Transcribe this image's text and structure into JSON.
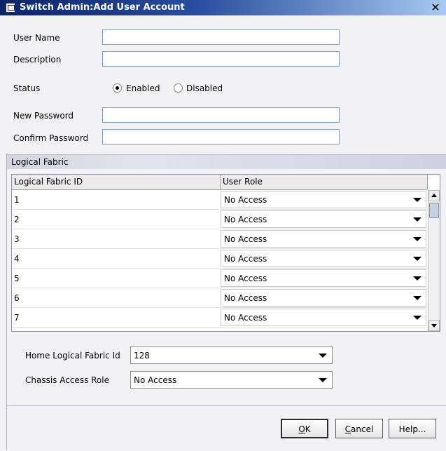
{
  "window": {
    "title": "Switch Admin:Add User Account",
    "close_glyph": "✕"
  },
  "form": {
    "user_name": {
      "label": "User Name",
      "value": ""
    },
    "description": {
      "label": "Description",
      "value": ""
    },
    "status": {
      "label": "Status",
      "options": [
        "Enabled",
        "Disabled"
      ],
      "selected": "Enabled"
    },
    "new_password": {
      "label": "New Password",
      "value": ""
    },
    "confirm_password": {
      "label": "Confirm Password",
      "value": ""
    }
  },
  "logical_fabric": {
    "section_title": "Logical Fabric",
    "columns": [
      "Logical Fabric ID",
      "User Role"
    ],
    "rows": [
      {
        "id": "1",
        "role": "No Access"
      },
      {
        "id": "2",
        "role": "No Access"
      },
      {
        "id": "3",
        "role": "No Access"
      },
      {
        "id": "4",
        "role": "No Access"
      },
      {
        "id": "5",
        "role": "No Access"
      },
      {
        "id": "6",
        "role": "No Access"
      },
      {
        "id": "7",
        "role": "No Access"
      }
    ],
    "home_fabric": {
      "label": "Home Logical Fabric Id",
      "value": "128"
    },
    "chassis_role": {
      "label": "Chassis Access Role",
      "value": "No Access"
    }
  },
  "buttons": {
    "ok": {
      "mnemonic": "O",
      "rest": "K"
    },
    "cancel": {
      "mnemonic": "C",
      "rest": "ancel"
    },
    "help": {
      "label": "Help..."
    }
  },
  "colors": {
    "title_start": "#0a246a",
    "title_end": "#a6caf0",
    "background": "#f2f2f4",
    "field_border": "#7f9db9"
  }
}
